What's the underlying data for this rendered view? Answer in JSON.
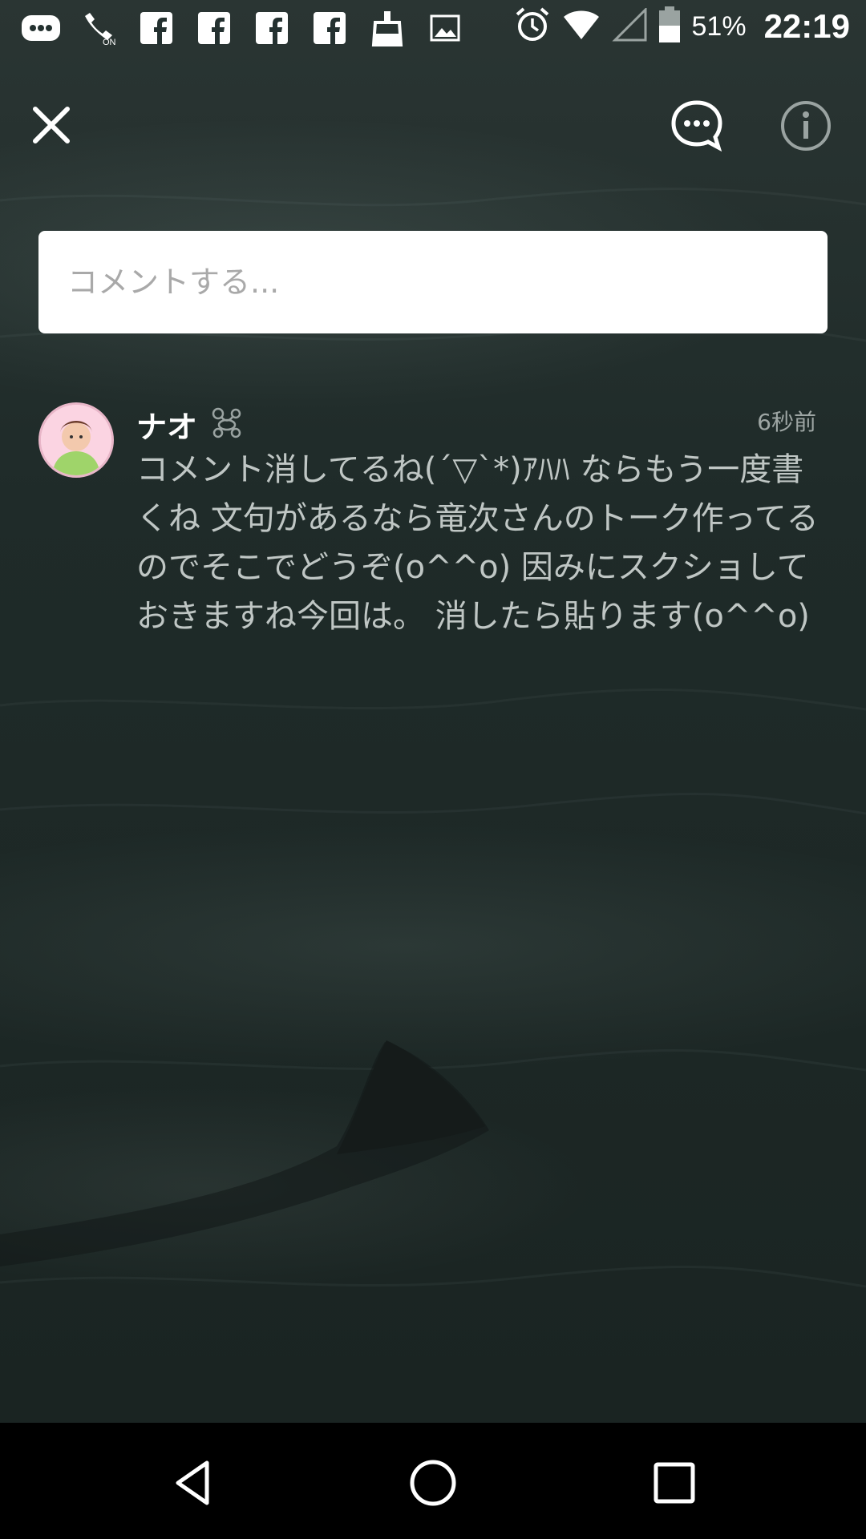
{
  "status_bar": {
    "left_icons": [
      "more-dots-icon",
      "wifi-calling-icon",
      "facebook-icon",
      "facebook-icon",
      "facebook-icon",
      "facebook-icon",
      "cleaner-icon",
      "image-icon"
    ],
    "right_icons": [
      "alarm-icon",
      "wifi-icon",
      "signal-icon",
      "battery-icon"
    ],
    "battery": "51%",
    "time": "22:19"
  },
  "top_bar": {
    "icons": [
      "close-icon",
      "chat-bubble-icon",
      "info-icon"
    ]
  },
  "comment_input": {
    "placeholder": "コメントする..."
  },
  "comments": [
    {
      "username": "ナオ",
      "badge_icon": "poodle-icon",
      "time": "6秒前",
      "body": "コメント消してるね(´▽`*)ｱﾊﾊ ならもう一度書くね 文句があるなら竜次さんのトーク作ってるのでそこでどうぞ(o^^o) 因みにスクショしておきますね今回は。 消したら貼ります(o^^o)"
    }
  ],
  "nav_bar": {
    "icons": [
      "back-icon",
      "home-icon",
      "recents-icon"
    ]
  },
  "colors": {
    "background": "#1d2826",
    "input_background": "#ffffff",
    "muted_text": "#9ea6a4"
  }
}
